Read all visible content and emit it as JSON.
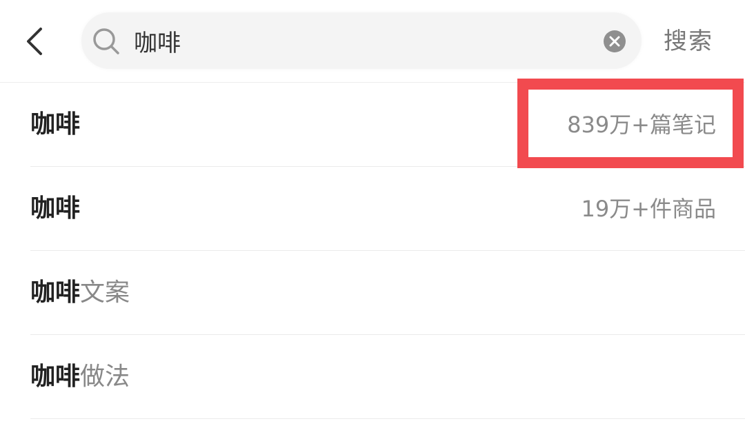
{
  "header": {
    "back_icon": "chevron-left-icon",
    "search": {
      "icon": "search-icon",
      "value": "咖啡",
      "clear_icon": "clear-circle-icon"
    },
    "search_button_label": "搜索"
  },
  "suggestions": [
    {
      "keyword": "咖啡",
      "suffix": "",
      "meta": "839万+篇笔记"
    },
    {
      "keyword": "咖啡",
      "suffix": "",
      "meta": "19万+件商品"
    },
    {
      "keyword": "咖啡",
      "suffix": "文案",
      "meta": ""
    },
    {
      "keyword": "咖啡",
      "suffix": "做法",
      "meta": ""
    }
  ],
  "colors": {
    "highlight_border": "#f24a4f",
    "search_bg": "#f4f4f4",
    "muted_text": "#888888"
  }
}
